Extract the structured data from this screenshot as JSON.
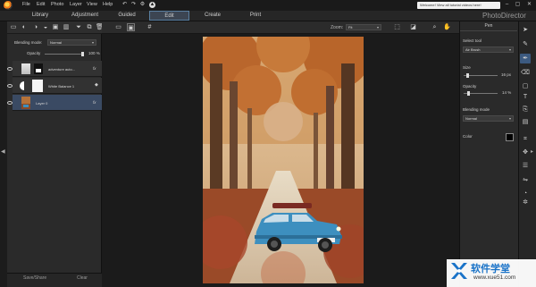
{
  "menu": {
    "items": [
      "File",
      "Edit",
      "Photo",
      "Layer",
      "View",
      "Help"
    ],
    "welcome_text": "Welcome! View all tutorial videos here!"
  },
  "tabs": {
    "library": "Library",
    "adjustment": "Adjustment",
    "guided": "Guided",
    "edit": "Edit",
    "create": "Create",
    "print": "Print"
  },
  "brand": "PhotoDirector",
  "left_panel": {
    "blending_label": "Blending mode:",
    "blending_value": "Normal",
    "opacity_label": "Opacity",
    "opacity_value": "100 %",
    "opacity_level": 1.0,
    "layers": [
      {
        "name": "adventure auto...",
        "fx": "fx"
      },
      {
        "name": "White Balance 1",
        "fx": ""
      },
      {
        "name": "Layer 0",
        "fx": "fx"
      }
    ],
    "save_share": "Save/Share",
    "clear": "Clear"
  },
  "center_toolbar": {
    "zoom_label": "Zoom:",
    "zoom_value": "Fit"
  },
  "right_panel": {
    "title": "Pen",
    "select_tool_label": "Select tool",
    "select_tool_value": "Air Brush",
    "size_label": "Size",
    "size_value": "16 px",
    "size_level": 0.12,
    "opacity_label": "Opacity",
    "opacity_value": "14 %",
    "opacity_level": 0.14,
    "blending_label": "Blending mode",
    "blending_value": "Normal",
    "color_label": "Color",
    "color_value": "#000000"
  },
  "watermark": {
    "title": "软件学堂",
    "url": "www.xue51.com"
  },
  "colors": {
    "accent": "#3c5a80",
    "selected_layer": "#3a4a63",
    "car": "#3d8fbf"
  },
  "icons": {
    "right_tools": [
      "pointer-icon",
      "selection-brush-icon",
      "pen-icon",
      "eraser-icon",
      "shape-icon",
      "text-icon",
      "clone-icon",
      "gradient-icon",
      "crop-icon",
      "transform-icon",
      "adjustments-icon",
      "flip-icon",
      "circle-icon",
      "settings-icon"
    ]
  }
}
